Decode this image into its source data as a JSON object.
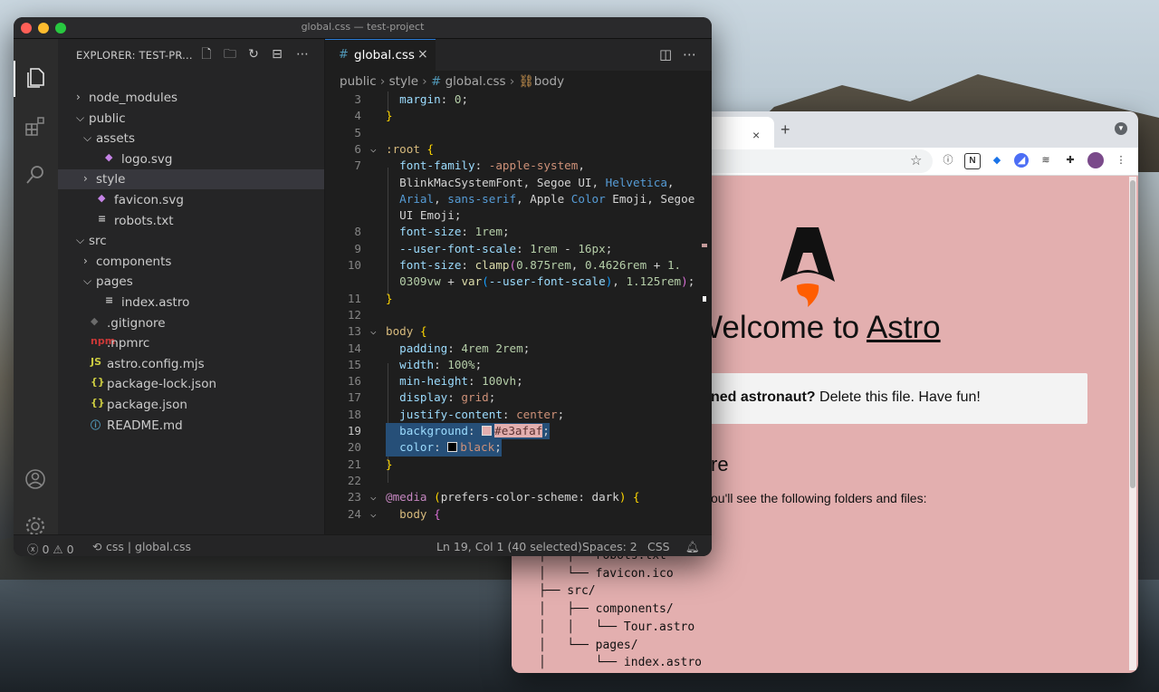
{
  "browser": {
    "tab_close": "×",
    "new_tab": "+",
    "page": {
      "heading_prefix": "Welcome to ",
      "heading_link": "Astro",
      "callout_bold": "ned astronaut?",
      "callout_rest": " Delete this file. Have fun!",
      "section_heading": "re",
      "paragraph": "ou'll see the following folders and files:",
      "tree_lines": [
        "│   ├── robots.txt",
        "│   └── favicon.ico",
        "├── src/",
        "│   ├── components/",
        "│   │   └── Tour.astro",
        "│   └── pages/",
        "│       └── index.astro"
      ]
    },
    "colors": {
      "background": "#e3afaf"
    }
  },
  "vscode": {
    "window_title": "global.css — test-project",
    "explorer_title": "EXPLORER: TEST-PR...",
    "tree": [
      {
        "label": "node_modules",
        "type": "folder",
        "state": "collapsed",
        "depth": 0
      },
      {
        "label": "public",
        "type": "folder",
        "state": "expanded",
        "depth": 0
      },
      {
        "label": "assets",
        "type": "folder",
        "state": "expanded",
        "depth": 1
      },
      {
        "label": "logo.svg",
        "type": "svg",
        "depth": 2
      },
      {
        "label": "style",
        "type": "folder",
        "state": "collapsed",
        "depth": 1,
        "selected": true
      },
      {
        "label": "favicon.svg",
        "type": "svg",
        "depth": 1
      },
      {
        "label": "robots.txt",
        "type": "txt",
        "depth": 1
      },
      {
        "label": "src",
        "type": "folder",
        "state": "expanded",
        "depth": 0
      },
      {
        "label": "components",
        "type": "folder",
        "state": "collapsed",
        "depth": 1
      },
      {
        "label": "pages",
        "type": "folder",
        "state": "expanded",
        "depth": 1
      },
      {
        "label": "index.astro",
        "type": "txt",
        "depth": 2
      },
      {
        "label": ".gitignore",
        "type": "git",
        "depth": 0
      },
      {
        "label": ".npmrc",
        "type": "npm",
        "depth": 0
      },
      {
        "label": "astro.config.mjs",
        "type": "js",
        "depth": 0
      },
      {
        "label": "package-lock.json",
        "type": "json",
        "depth": 0
      },
      {
        "label": "package.json",
        "type": "json",
        "depth": 0
      },
      {
        "label": "README.md",
        "type": "info",
        "depth": 0
      }
    ],
    "tab_label": "global.css",
    "breadcrumbs": [
      "public",
      "style",
      "global.css",
      "body"
    ],
    "status": {
      "errors": "0",
      "warnings": "0",
      "language_path": "css | global.css",
      "cursor": "Ln 19, Col 1 (40 selected)",
      "spaces": "Spaces: 2",
      "language": "CSS"
    }
  }
}
